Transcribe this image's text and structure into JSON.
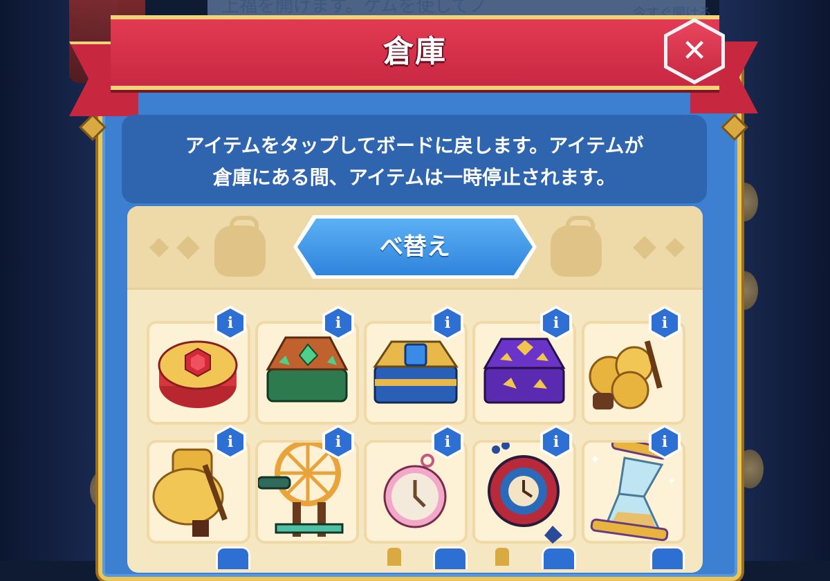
{
  "window": {
    "title": "倉庫"
  },
  "background": {
    "top_text": "上福を開けます。ケムを使してノ",
    "top_right_text": "今すぐ開ける"
  },
  "info": {
    "line1": "アイテムをタップしてボードに戻します。アイテムが",
    "line2": "倉庫にある間、アイテムは一時停止されます。"
  },
  "sort_button": {
    "label": "べ替え"
  },
  "close_button": {
    "label": "✕"
  },
  "info_badge": {
    "label": "i"
  },
  "colors": {
    "ribbon": "#c8283f",
    "panel": "#3d7fd0",
    "frame_gold": "#e9c65a",
    "storage_bg": "#f6e7c3",
    "info_badge": "#2e6fd4",
    "sort_button": "#2f84dc"
  },
  "items": [
    {
      "name": "ruby-gem-drum",
      "icon": "red-gem-drum"
    },
    {
      "name": "emerald-chest",
      "icon": "green-gem-chest"
    },
    {
      "name": "sapphire-chest",
      "icon": "blue-gem-chest"
    },
    {
      "name": "amethyst-chest",
      "icon": "purple-gem-chest"
    },
    {
      "name": "hay-bales-small",
      "icon": "hay-pitchfork"
    },
    {
      "name": "hay-bales-large",
      "icon": "hay-pile-pitchfork"
    },
    {
      "name": "spinning-wheel",
      "icon": "spinning-wheel"
    },
    {
      "name": "pocket-watch",
      "icon": "pink-pocket-watch"
    },
    {
      "name": "ornate-clock",
      "icon": "blue-red-clock"
    },
    {
      "name": "golden-hourglass",
      "icon": "sparkling-hourglass"
    }
  ]
}
